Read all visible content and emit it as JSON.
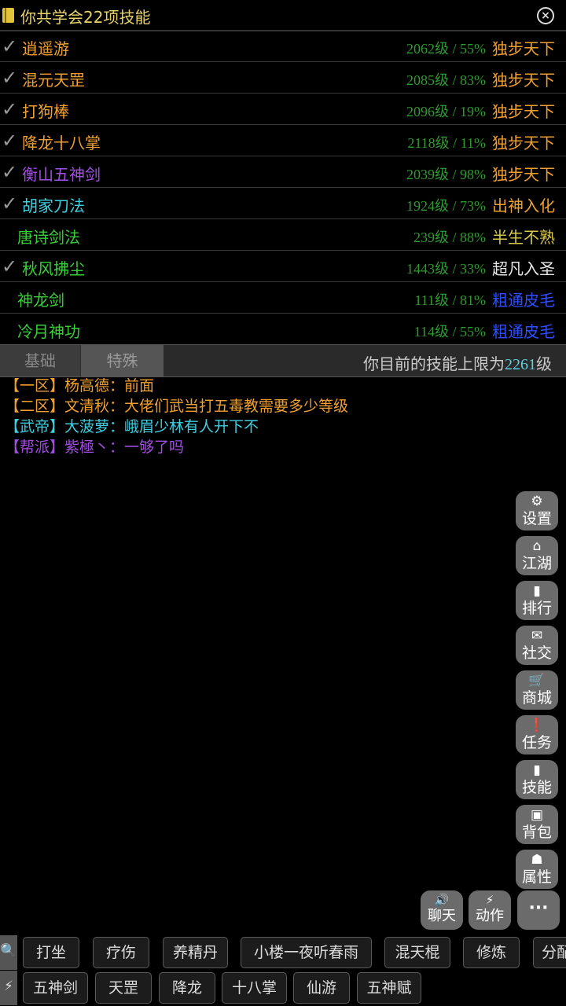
{
  "header": {
    "title": "你共学会22项技能",
    "book_icon": "book-icon",
    "close_icon": "close-icon"
  },
  "skills": [
    {
      "checked": true,
      "name": "逍遥游",
      "meta": "2062级 / 55%",
      "rank": "独步天下",
      "name_color": "#f0a030",
      "rank_color": "#f0a030"
    },
    {
      "checked": true,
      "name": "混元天罡",
      "meta": "2085级 / 83%",
      "rank": "独步天下",
      "name_color": "#f0a030",
      "rank_color": "#f0a030"
    },
    {
      "checked": true,
      "name": "打狗棒",
      "meta": "2096级 / 19%",
      "rank": "独步天下",
      "name_color": "#f0a030",
      "rank_color": "#f0a030"
    },
    {
      "checked": true,
      "name": "降龙十八掌",
      "meta": "2118级 / 11%",
      "rank": "独步天下",
      "name_color": "#f0a030",
      "rank_color": "#f0a030"
    },
    {
      "checked": true,
      "name": "衡山五神剑",
      "meta": "2039级 / 98%",
      "rank": "独步天下",
      "name_color": "#a14fe0",
      "rank_color": "#f0a030"
    },
    {
      "checked": true,
      "name": "胡家刀法",
      "meta": "1924级 / 73%",
      "rank": "出神入化",
      "name_color": "#3ecfe0",
      "rank_color": "#f0a030"
    },
    {
      "checked": false,
      "name": "唐诗剑法",
      "meta": "239级 / 88%",
      "rank": "半生不熟",
      "name_color": "#36d136",
      "rank_color": "#d8c84a"
    },
    {
      "checked": true,
      "name": "秋风拂尘",
      "meta": "1443级 / 33%",
      "rank": "超凡入圣",
      "name_color": "#36d136",
      "rank_color": "#e6e6e6"
    },
    {
      "checked": false,
      "name": "神龙剑",
      "meta": "111级 / 81%",
      "rank": "粗通皮毛",
      "name_color": "#36d136",
      "rank_color": "#2f4fff"
    },
    {
      "checked": false,
      "name": "冷月神功",
      "meta": "114级 / 55%",
      "rank": "粗通皮毛",
      "name_color": "#36d136",
      "rank_color": "#2f4fff"
    }
  ],
  "tabs": {
    "basic": "基础",
    "special": "特殊"
  },
  "limit": {
    "prefix": "你目前的技能上限为",
    "value": "2261",
    "suffix": "级"
  },
  "chat": [
    {
      "channel": "【一区】",
      "user": "杨高德：",
      "text": "前面",
      "color": "#f0a030"
    },
    {
      "channel": "【二区】",
      "user": "文清秋：",
      "text": "大佬们武当打五毒教需要多少等级",
      "color": "#f0a030"
    },
    {
      "channel": "【武帝】",
      "user": "大菠萝：",
      "text": "峨眉少林有人开下不",
      "color": "#3ecfe0"
    },
    {
      "channel": "【帮派】",
      "user": "紫極丶：",
      "text": "一够了吗",
      "color": "#a14fe0"
    }
  ],
  "side_menu": [
    {
      "label": "设置",
      "icon": "gear-icon",
      "glyph": "⚙"
    },
    {
      "label": "江湖",
      "icon": "home-icon",
      "glyph": "⌂"
    },
    {
      "label": "排行",
      "icon": "chart-icon",
      "glyph": "▮"
    },
    {
      "label": "社交",
      "icon": "mail-icon",
      "glyph": "✉"
    },
    {
      "label": "商城",
      "icon": "cart-icon",
      "glyph": "🛒"
    },
    {
      "label": "任务",
      "icon": "alert-icon",
      "glyph": "❗"
    },
    {
      "label": "技能",
      "icon": "book-icon",
      "glyph": "▮"
    },
    {
      "label": "背包",
      "icon": "bag-icon",
      "glyph": "▣"
    },
    {
      "label": "属性",
      "icon": "person-icon",
      "glyph": "☗"
    }
  ],
  "bottom_buttons": [
    {
      "label": "聊天",
      "icon": "speaker-icon",
      "glyph": "🔊"
    },
    {
      "label": "动作",
      "icon": "bolt-icon",
      "glyph": "⚡"
    },
    {
      "label": "···",
      "icon": "more-icon",
      "glyph": ""
    }
  ],
  "quickbar1": {
    "icon": "search-icon",
    "glyph": "🔍",
    "items": [
      "打坐",
      "疗伤",
      "养精丹",
      "小楼一夜听春雨",
      "混天棍",
      "修炼",
      "分配"
    ]
  },
  "quickbar2": {
    "icon": "bolt-icon",
    "glyph": "⚡",
    "items": [
      "五神剑",
      "天罡",
      "降龙",
      "十八掌",
      "仙游",
      "五神赋"
    ]
  }
}
